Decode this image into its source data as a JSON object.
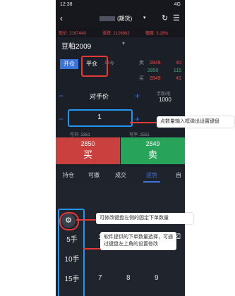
{
  "status_bar": {
    "time": "12:38",
    "right": "4G"
  },
  "header": {
    "title": "(期货)"
  },
  "ticker": {
    "items": [
      "现价: 2187449",
      "涨跌: 2126882",
      "幅度: 3.28%"
    ]
  },
  "contract": {
    "name": "豆粕2009"
  },
  "order_book": [
    {
      "label": "卖",
      "price": "2849",
      "qty": "40"
    },
    {
      "label": "",
      "price": "2850",
      "qty": "115"
    },
    {
      "label": "买",
      "price": "2849",
      "qty": "41"
    }
  ],
  "mode": {
    "open": "开仓",
    "close": "平仓",
    "today": "平今"
  },
  "price": {
    "type": "对手价",
    "lots_label": "手数/批",
    "lots_value": "1000"
  },
  "quantity": {
    "value": "1"
  },
  "stats": {
    "left": "可开: 2361",
    "right": "可平: 2551"
  },
  "trade": {
    "buy_price": "2850",
    "buy_label": "买",
    "sell_price": "2849",
    "sell_label": "卖"
  },
  "tabs": [
    "持仓",
    "可撤",
    "成交",
    "运势",
    "自"
  ],
  "quick": {
    "item1": "5手",
    "item2": "10手",
    "item3": "15手"
  },
  "keypad": {
    "k1": "1",
    "k2": "2",
    "k3": "3",
    "k7": "7",
    "k8": "8",
    "k9": "9",
    "del": "⌫"
  },
  "annotations": {
    "a1": "点数量输入框弹出设置键盘",
    "a2": "可修改键盘左侧的固定下单数量",
    "a3": "软件提供的下单数量选择，可通过键盘左上角的设置修改"
  }
}
